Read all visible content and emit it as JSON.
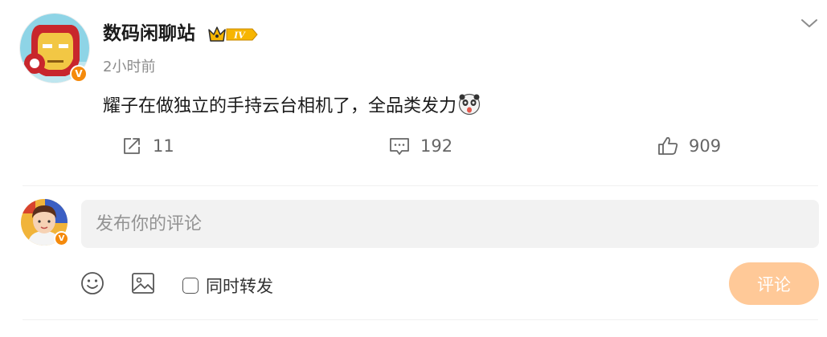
{
  "post": {
    "author_name": "数码闲聊站",
    "vip_level": "IV",
    "time": "2小时前",
    "content": "耀子在做独立的手持云台相机了，全品类发力",
    "verified_mark": "V",
    "emoji_icon": "panda-surprised-emoji",
    "actions": {
      "repost_count": "11",
      "comment_count": "192",
      "like_count": "909"
    }
  },
  "composer": {
    "placeholder": "发布你的评论",
    "repost_label": "同时转发",
    "submit_label": "评论",
    "verified_mark": "V"
  },
  "colors": {
    "accent_orange": "#f58a0c",
    "submit_disabled": "#ffc998",
    "input_bg": "#f2f2f2",
    "muted_text": "#8c8c8c"
  }
}
